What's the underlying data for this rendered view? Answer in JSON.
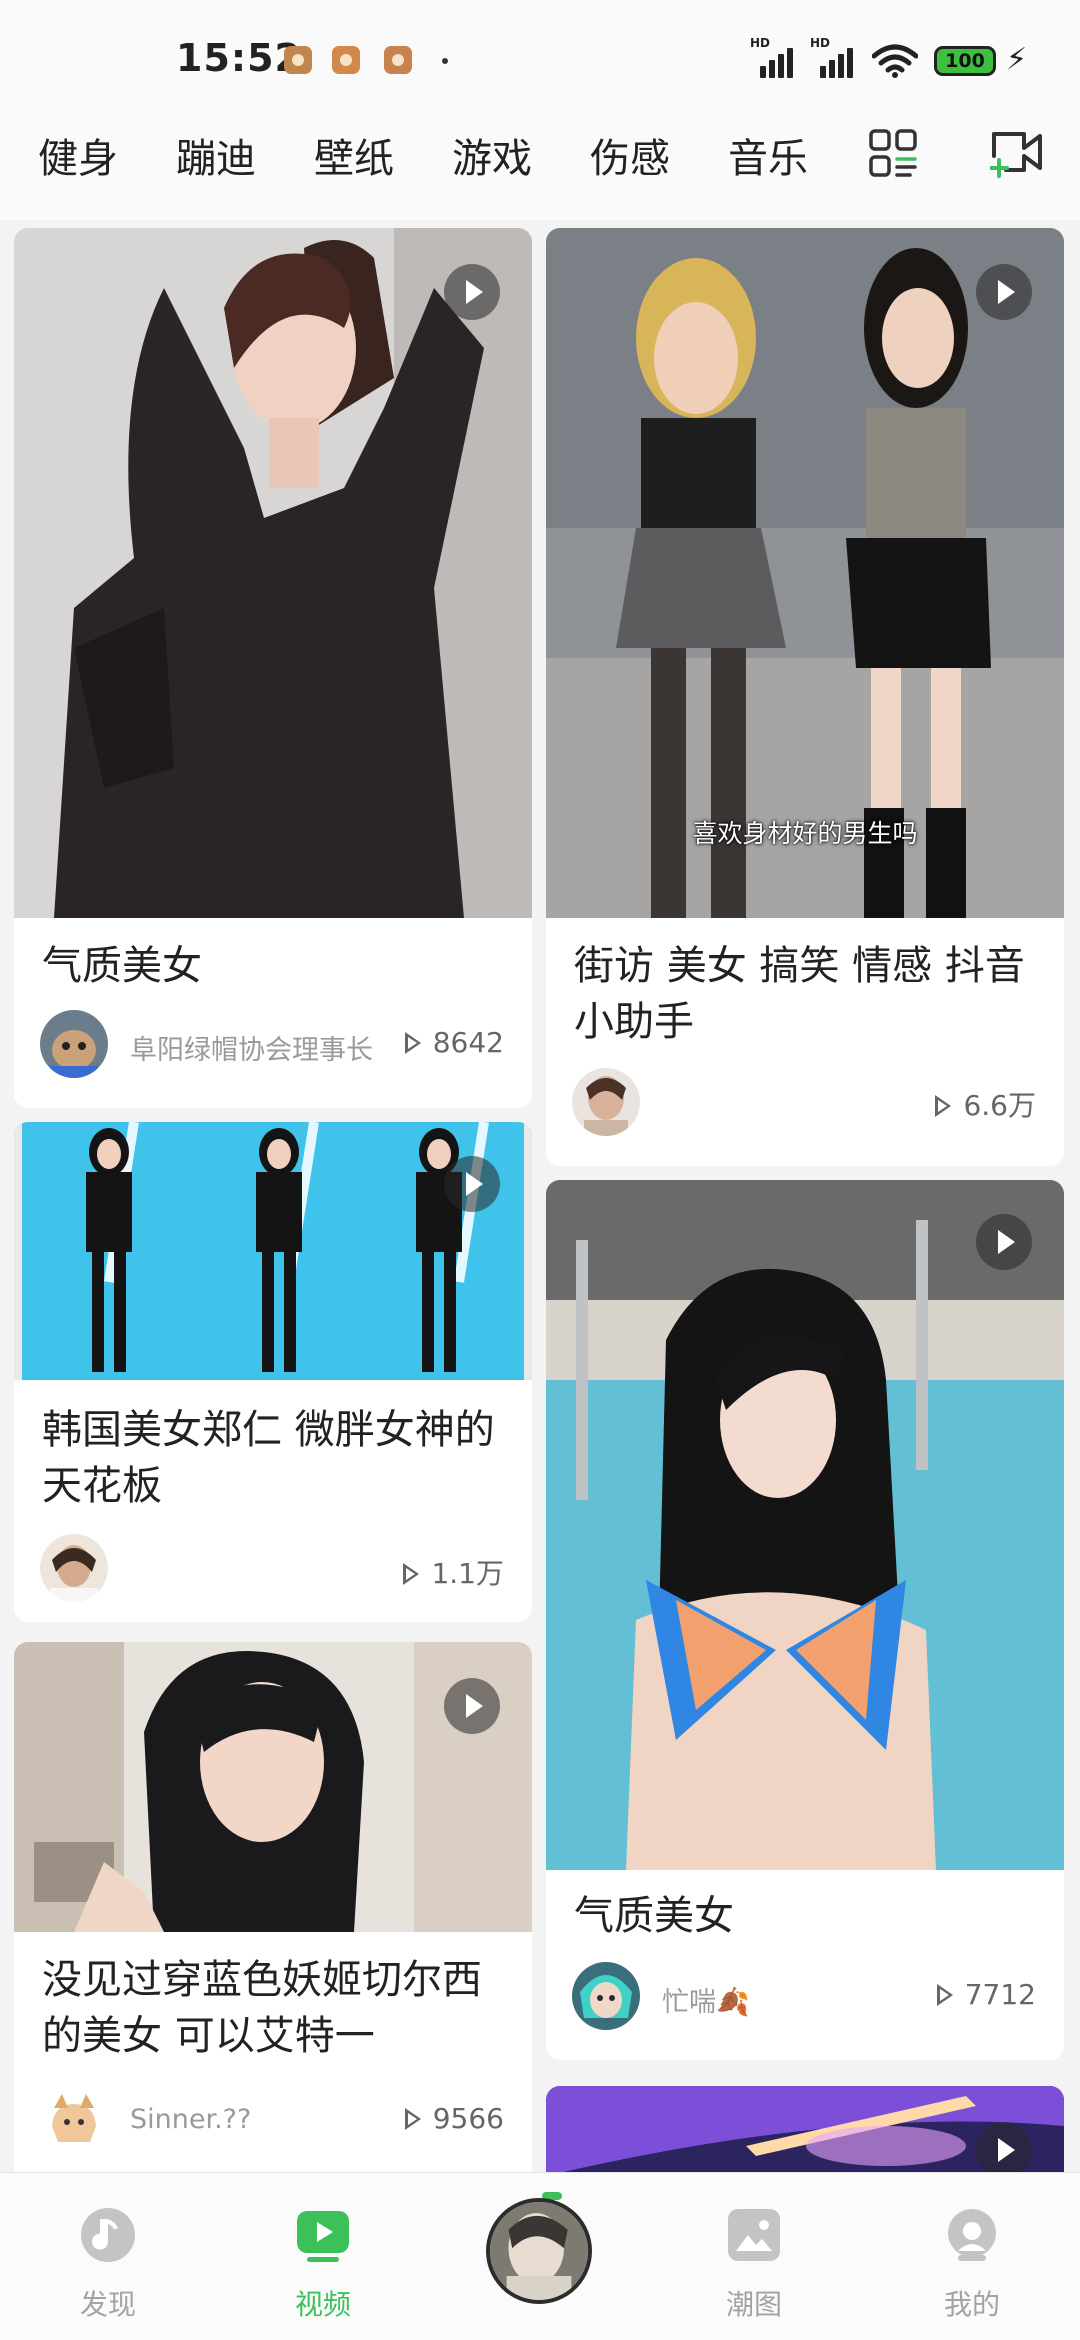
{
  "status_bar": {
    "time": "15:52",
    "signal_1_label": "HD",
    "signal_2_label": "HD",
    "battery": "100",
    "charging_icon": "lightning-bolt-icon"
  },
  "categories": [
    "健身",
    "蹦迪",
    "壁纸",
    "游戏",
    "伤感",
    "音乐"
  ],
  "toolbar_icons": [
    "category-grid-icon",
    "video-camera-add-icon"
  ],
  "cards": [
    {
      "title": "气质美女",
      "author": "阜阳绿帽协会理事长",
      "plays": "8642"
    },
    {
      "title": "街访 美女 搞笑 情感 抖音小助手",
      "author": "",
      "plays": "6.6万",
      "overlay_caption": "喜欢身材好的男生吗"
    },
    {
      "title": "韩国美女郑仁 微胖女神的天花板",
      "author": "",
      "plays": "1.1万"
    },
    {
      "title": "气质美女",
      "author": "忙喘🍂",
      "plays": "7712"
    },
    {
      "title": "没见过穿蓝色妖姬切尔西的美女  可以艾特一",
      "author": "Sinner.??",
      "plays": "9566"
    }
  ],
  "nav": {
    "items": [
      {
        "label": "发现",
        "icon": "music-note-disc-icon"
      },
      {
        "label": "视频",
        "icon": "video-play-icon"
      },
      {
        "label": "潮图",
        "icon": "image-icon"
      },
      {
        "label": "我的",
        "icon": "user-profile-icon"
      }
    ],
    "active": "视频",
    "accent_color": "#3cc15a",
    "inactive_color": "#a3a3a3"
  }
}
